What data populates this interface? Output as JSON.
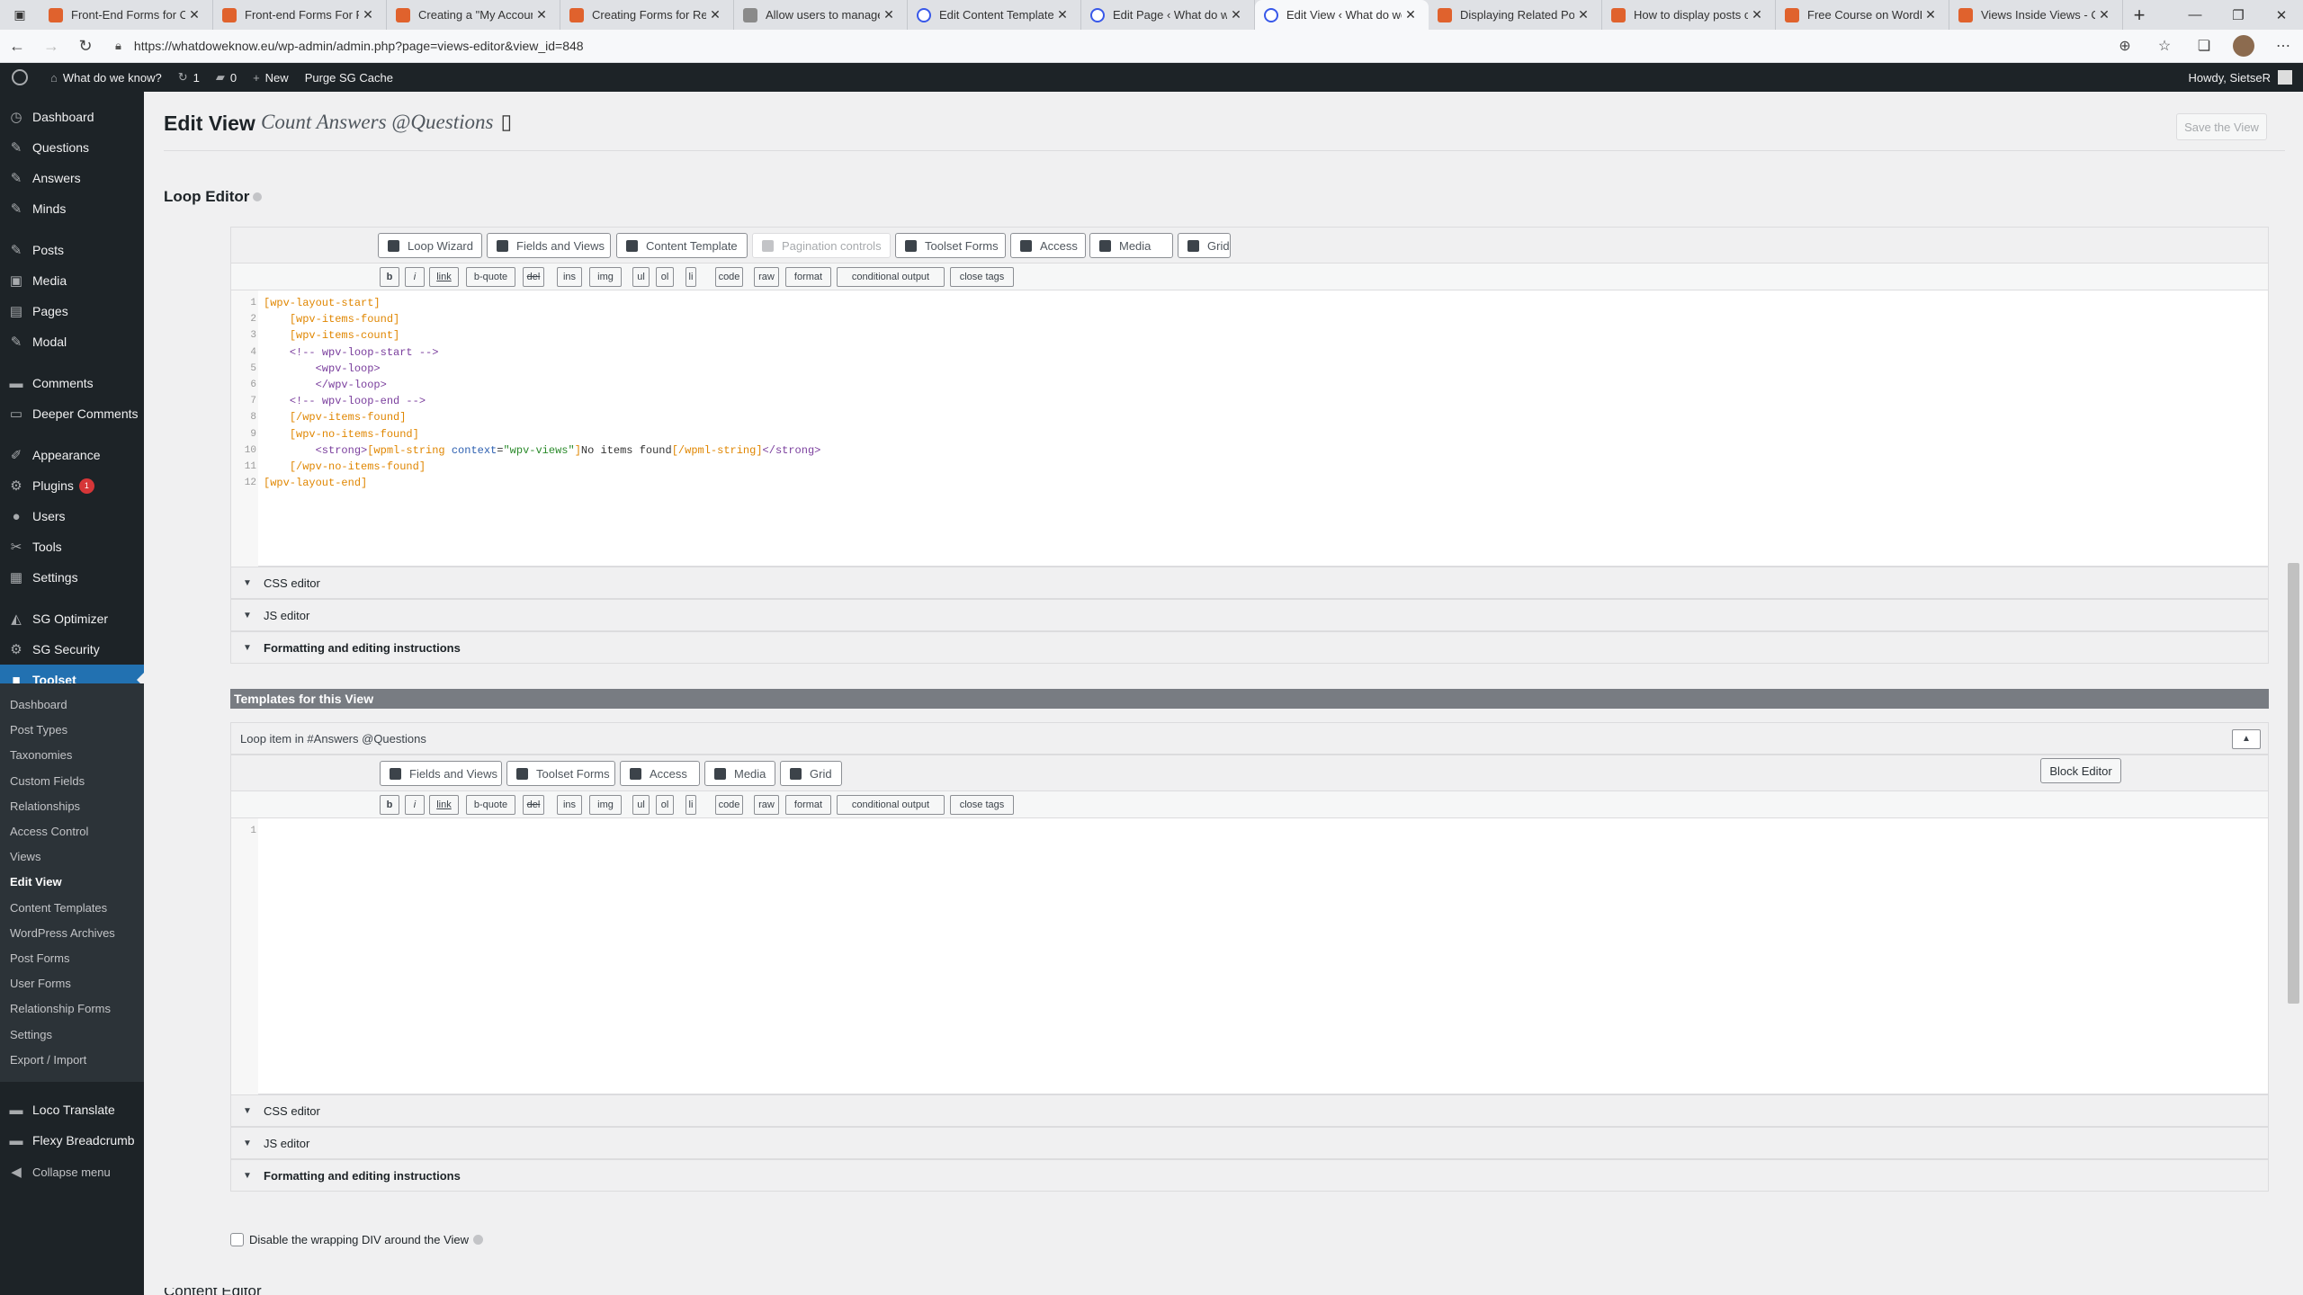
{
  "browser": {
    "tabs": [
      {
        "title": "Front-End Forms for Co",
        "fav": "toolset"
      },
      {
        "title": "Front-end Forms For Re",
        "fav": "toolset"
      },
      {
        "title": "Creating a \"My Account",
        "fav": "toolset"
      },
      {
        "title": "Creating Forms for Rep",
        "fav": "toolset"
      },
      {
        "title": "Allow users to manage",
        "fav": "grey"
      },
      {
        "title": "Edit Content Template",
        "fav": "wp"
      },
      {
        "title": "Edit Page ‹ What do we",
        "fav": "wp"
      },
      {
        "title": "Edit View ‹ What do we",
        "fav": "wp",
        "active": true
      },
      {
        "title": "Displaying Related Posts",
        "fav": "toolset"
      },
      {
        "title": "How to display posts co",
        "fav": "toolset"
      },
      {
        "title": "Free Course on WordPr",
        "fav": "toolset"
      },
      {
        "title": "Views Inside Views - Cr",
        "fav": "toolset"
      }
    ],
    "url": "https://whatdoweknow.eu/wp-admin/admin.php?page=views-editor&view_id=848"
  },
  "adminbar": {
    "site": "What do we know?",
    "updates": "1",
    "comments": "0",
    "new": "New",
    "purge": "Purge SG Cache",
    "howdy": "Howdy, SietseR"
  },
  "sidebar": {
    "items": [
      {
        "label": "Dashboard",
        "icon": "dashboard-icon",
        "glyph": "◷"
      },
      {
        "label": "Questions",
        "icon": "pin-icon",
        "glyph": "✎"
      },
      {
        "label": "Answers",
        "icon": "pin-icon",
        "glyph": "✎"
      },
      {
        "label": "Minds",
        "icon": "pin-icon",
        "glyph": "✎"
      },
      {
        "label": "Posts",
        "icon": "pin-icon",
        "glyph": "✎"
      },
      {
        "label": "Media",
        "icon": "media-icon",
        "glyph": "▣"
      },
      {
        "label": "Pages",
        "icon": "pages-icon",
        "glyph": "▤"
      },
      {
        "label": "Modal",
        "icon": "pin-icon",
        "glyph": "✎"
      },
      {
        "label": "Comments",
        "icon": "comments-icon",
        "glyph": "▬"
      },
      {
        "label": "Deeper Comments",
        "icon": "comments-icon",
        "glyph": "▭"
      },
      {
        "label": "Appearance",
        "icon": "appearance-icon",
        "glyph": "✐"
      },
      {
        "label": "Plugins",
        "icon": "plugins-icon",
        "glyph": "⚙",
        "badge": "1"
      },
      {
        "label": "Users",
        "icon": "users-icon",
        "glyph": "●"
      },
      {
        "label": "Tools",
        "icon": "tools-icon",
        "glyph": "✂"
      },
      {
        "label": "Settings",
        "icon": "settings-icon",
        "glyph": "▦"
      },
      {
        "label": "SG Optimizer",
        "icon": "sg-optimizer-icon",
        "glyph": "◭"
      },
      {
        "label": "SG Security",
        "icon": "sg-security-icon",
        "glyph": "⚙"
      },
      {
        "label": "Toolset",
        "icon": "toolset-icon",
        "glyph": "■",
        "current": true
      }
    ],
    "submenu": [
      "Dashboard",
      "Post Types",
      "Taxonomies",
      "Custom Fields",
      "Relationships",
      "Access Control",
      "Views",
      "Edit View",
      "Content Templates",
      "WordPress Archives",
      "Post Forms",
      "User Forms",
      "Relationship Forms",
      "Settings",
      "Export / Import"
    ],
    "after": [
      {
        "label": "Loco Translate",
        "icon": "translate-icon",
        "glyph": "▬"
      },
      {
        "label": "Flexy Breadcrumb",
        "icon": "breadcrumb-icon",
        "glyph": "▬"
      }
    ],
    "collapse": "Collapse menu"
  },
  "page": {
    "title": "Edit View",
    "view_name": "Count Answers @Questions",
    "save_label": "Save the View",
    "loop_editor_title": "Loop Editor"
  },
  "loop_toolbar": [
    "Loop Wizard",
    "Fields and Views",
    "Content Template",
    "Pagination controls",
    "Toolset Forms",
    "Access",
    "Media",
    "Grid"
  ],
  "quicktags": [
    "b",
    "i",
    "link",
    "b-quote",
    "del",
    "ins",
    "img",
    "ul",
    "ol",
    "li",
    "code",
    "raw",
    "format",
    "conditional output",
    "close tags"
  ],
  "code_lines": [
    "[wpv-layout-start]",
    "    [wpv-items-found]",
    "    [wpv-items-count]",
    "    <!-- wpv-loop-start -->",
    "        <wpv-loop>",
    "        </wpv-loop>",
    "    <!-- wpv-loop-end -->",
    "    [/wpv-items-found]",
    "    [wpv-no-items-found]",
    "        <strong>[wpml-string context=\"wpv-views\"]No items found[/wpml-string]</strong>",
    "    [/wpv-no-items-found]",
    "[wpv-layout-end]"
  ],
  "accordions": [
    "CSS editor",
    "JS editor",
    "Formatting and editing instructions"
  ],
  "templates": {
    "header": "Templates for this View",
    "loop_item": "Loop item in #Answers @Questions",
    "toolbar": [
      "Fields and Views",
      "Toolset Forms",
      "Access",
      "Media",
      "Grid"
    ],
    "block_editor": "Block Editor",
    "line1": "1"
  },
  "wrap_div_label": "Disable the wrapping DIV around the View",
  "content_editor_partial": "Content Editor"
}
